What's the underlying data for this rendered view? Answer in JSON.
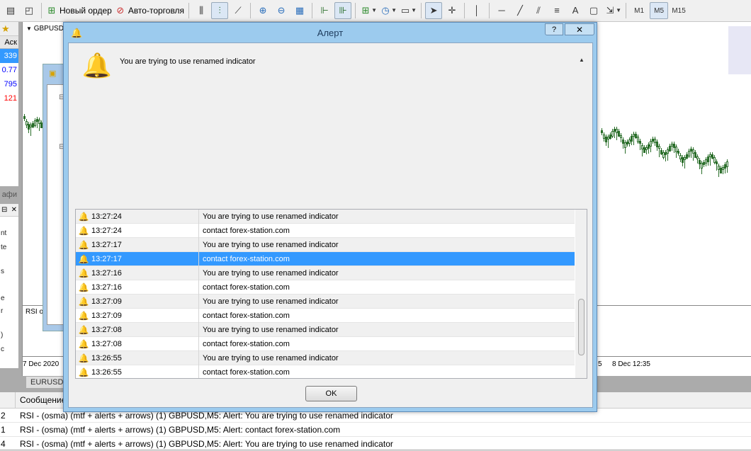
{
  "toolbar": {
    "new_order_label": "Новый ордер",
    "autotrading_label": "Авто-торговля",
    "timeframes": [
      "M1",
      "M5",
      "M15"
    ]
  },
  "market_watch": {
    "header": "Аск",
    "prices": [
      "339",
      "0.77",
      "795",
      "121"
    ],
    "price_colors": [
      "#ffffff",
      "#0000ff",
      "#0000ff",
      "#ff0000"
    ],
    "tab_label": "афи"
  },
  "navigator": {
    "fragments": [
      "nt",
      "te",
      "s",
      "e",
      "r",
      ")",
      "c"
    ]
  },
  "chart": {
    "symbol": "GBPUSD,M5",
    "indicator_label": "RSI o",
    "x_labels": [
      "7 Dec 2020",
      "5",
      "8 Dec 12:35"
    ],
    "symbol_tab": "EURUSD,"
  },
  "dialog": {
    "title": "Алерт",
    "help_label": "?",
    "close_label": "✕",
    "message": "You are trying to use renamed indicator",
    "ok_label": "OK",
    "alerts": [
      {
        "time": "13:27:24",
        "text": "You are trying to use renamed indicator"
      },
      {
        "time": "13:27:24",
        "text": "contact forex-station.com"
      },
      {
        "time": "13:27:17",
        "text": "You are trying to use renamed indicator"
      },
      {
        "time": "13:27:17",
        "text": "contact forex-station.com"
      },
      {
        "time": "13:27:16",
        "text": "You are trying to use renamed indicator"
      },
      {
        "time": "13:27:16",
        "text": "contact forex-station.com"
      },
      {
        "time": "13:27:09",
        "text": "You are trying to use renamed indicator"
      },
      {
        "time": "13:27:09",
        "text": "contact forex-station.com"
      },
      {
        "time": "13:27:08",
        "text": "You are trying to use renamed indicator"
      },
      {
        "time": "13:27:08",
        "text": "contact forex-station.com"
      },
      {
        "time": "13:26:55",
        "text": "You are trying to use renamed indicator"
      },
      {
        "time": "13:26:55",
        "text": "contact forex-station.com"
      }
    ],
    "selected_index": 3
  },
  "terminal": {
    "header": "Сообщение",
    "rows": [
      {
        "num": "2",
        "msg": "RSI - (osma) (mtf + alerts + arrows) (1) GBPUSD,M5: Alert: You are trying to use renamed indicator"
      },
      {
        "num": "1",
        "msg": "RSI - (osma) (mtf + alerts + arrows) (1) GBPUSD,M5: Alert: contact forex-station.com"
      },
      {
        "num": "4",
        "msg": "RSI - (osma) (mtf + alerts + arrows) (1) GBPUSD,M5: Alert: You are trying to use renamed indicator"
      }
    ]
  }
}
